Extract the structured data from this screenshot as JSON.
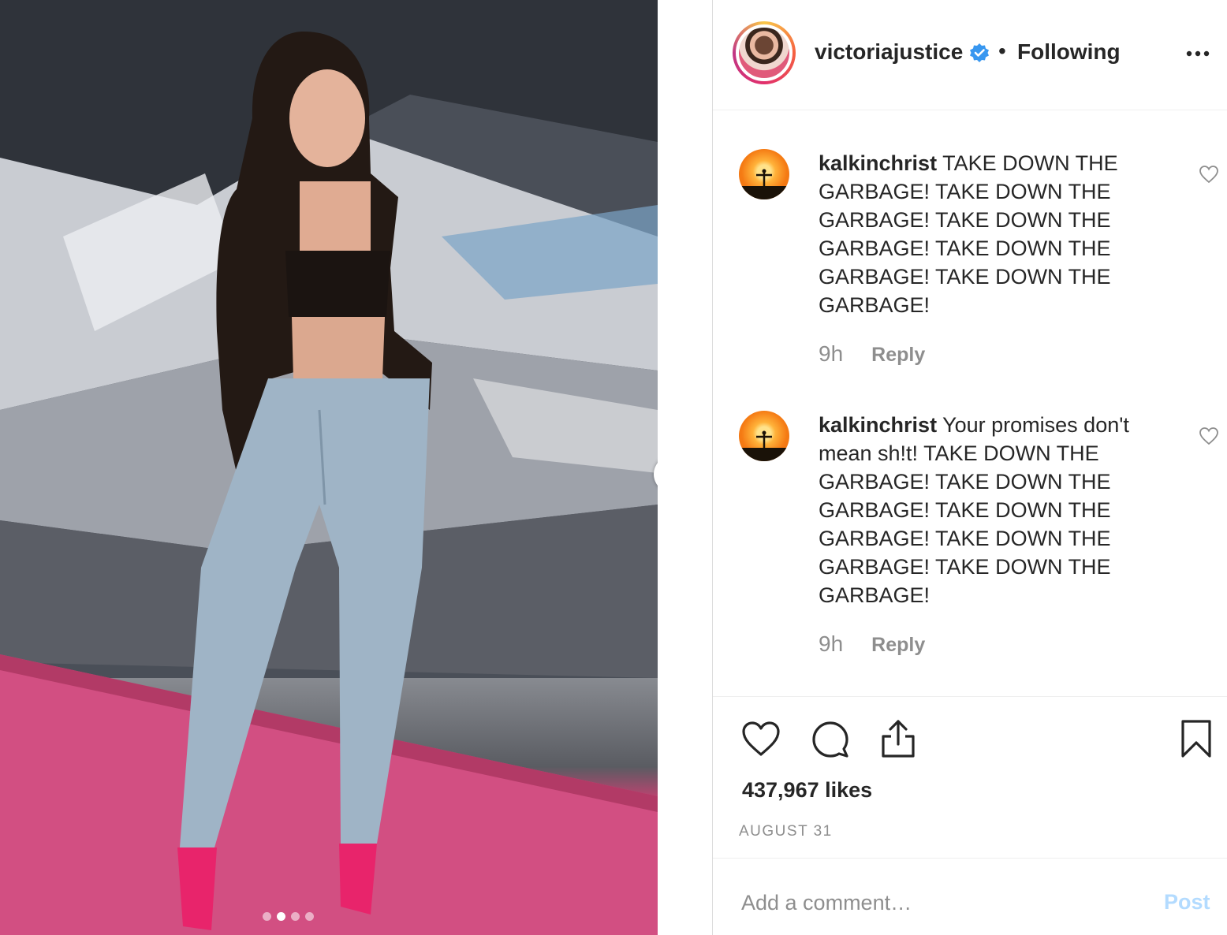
{
  "post": {
    "carousel": {
      "slide_count": 4,
      "active_slide": 2
    },
    "icons": {
      "next": "chevron-right-icon",
      "verified": "verified-badge-icon",
      "more": "more-options-icon",
      "like": "heart-icon",
      "comment": "comment-bubble-icon",
      "share": "share-icon",
      "save": "bookmark-icon"
    }
  },
  "header": {
    "username": "victoriajustice",
    "separator": "•",
    "follow_state": "Following"
  },
  "comments": [
    {
      "username": "kalkinchrist",
      "text": " TAKE DOWN THE GARBAGE! TAKE DOWN THE GARBAGE! TAKE DOWN THE GARBAGE! TAKE DOWN THE GARBAGE! TAKE DOWN THE GARBAGE!",
      "time": "9h",
      "reply_label": "Reply"
    },
    {
      "username": "kalkinchrist",
      "text": " Your promises don't mean sh!t! TAKE DOWN THE GARBAGE! TAKE DOWN THE GARBAGE! TAKE DOWN THE GARBAGE! TAKE DOWN THE GARBAGE! TAKE DOWN THE GARBAGE!",
      "time": "9h",
      "reply_label": "Reply"
    }
  ],
  "stats": {
    "likes": "437,967 likes",
    "date": "AUGUST 31"
  },
  "comment_box": {
    "placeholder": "Add a comment…",
    "post_label": "Post"
  },
  "colors": {
    "text": "#262626",
    "muted": "#8e8e8e",
    "verified_blue": "#3897f0",
    "post_disabled": "#b3dbff",
    "floor_pink": "#d8578a"
  }
}
